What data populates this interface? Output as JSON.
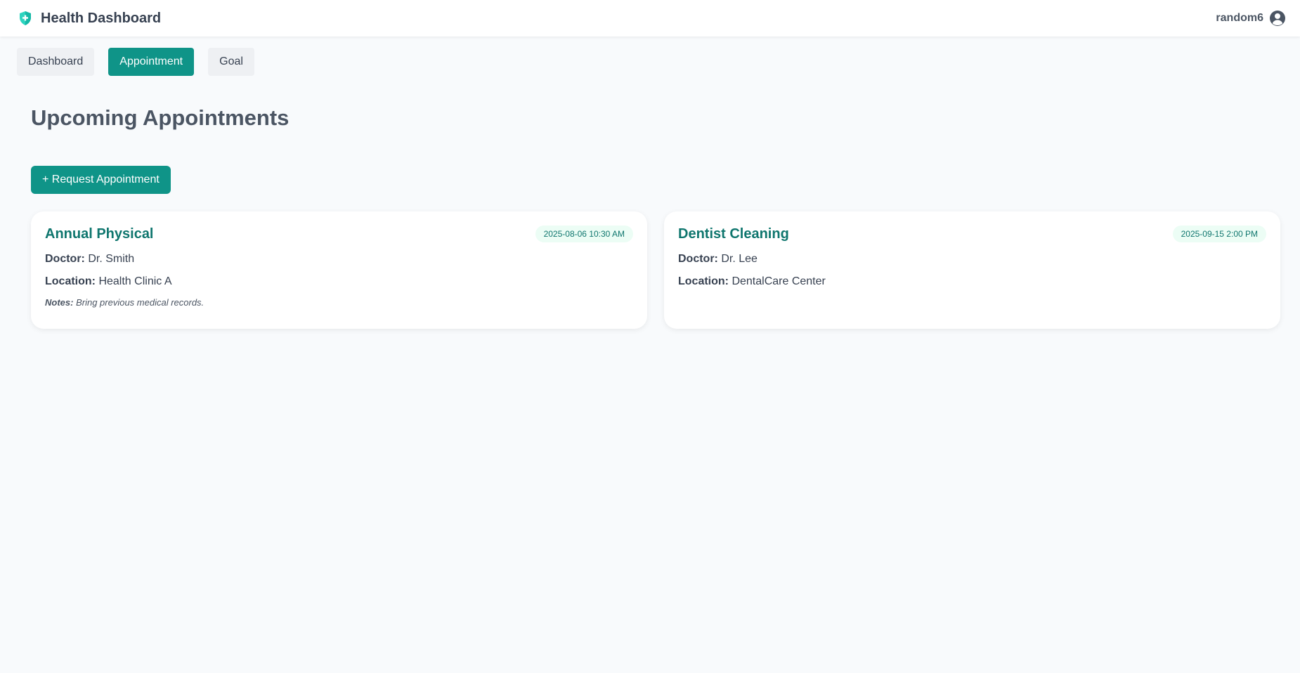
{
  "header": {
    "title": "Health Dashboard",
    "username": "random6",
    "brand_icon": "shield-plus-icon",
    "avatar_icon": "user-circle-icon"
  },
  "nav": {
    "tabs": [
      {
        "label": "Dashboard",
        "active": false
      },
      {
        "label": "Appointment",
        "active": true
      },
      {
        "label": "Goal",
        "active": false
      }
    ]
  },
  "main": {
    "title": "Upcoming Appointments",
    "request_button": "+ Request Appointment",
    "appointments": [
      {
        "title": "Annual Physical",
        "datetime": "2025-08-06 10:30 AM",
        "doctor_label": "Doctor:",
        "doctor": "Dr. Smith",
        "location_label": "Location:",
        "location": "Health Clinic A",
        "notes_label": "Notes:",
        "notes": "Bring previous medical records."
      },
      {
        "title": "Dentist Cleaning",
        "datetime": "2025-09-15 2:00 PM",
        "doctor_label": "Doctor:",
        "doctor": "Dr. Lee",
        "location_label": "Location:",
        "location": "DentalCare Center"
      }
    ]
  },
  "colors": {
    "accent": "#0f9488",
    "accent_text": "#0f766e",
    "background": "#f8fafc"
  }
}
